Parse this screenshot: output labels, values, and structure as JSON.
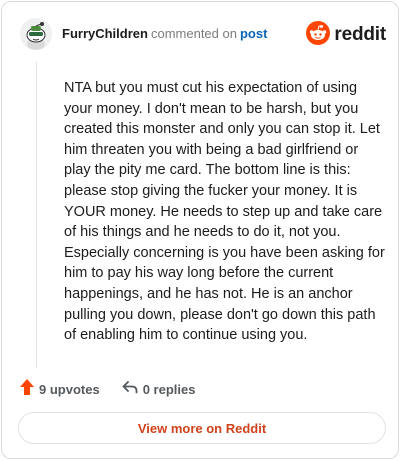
{
  "header": {
    "username": "FurryChildren",
    "action_text": "commented on",
    "post_link": "post",
    "brand_name": "reddit"
  },
  "icons": {
    "avatar": "snoo-avatar-icon",
    "brand": "reddit-logo-icon",
    "upvote": "upvote-arrow-icon",
    "reply": "reply-arrow-icon"
  },
  "comment": {
    "text": "NTA but you must cut his expectation of using your money. I don't mean to be harsh, but you created this monster and only you can stop it. Let him threaten you with being a bad girlfriend or play the pity me card. The bottom line is this: please stop giving the fucker your money. It is YOUR money. He needs to step up and take care of his things and he needs to do it, not you. Especially concerning is you have been asking for him to pay his way long before the current happenings, and he has not. He is an anchor pulling you down, please don't go down this path of enabling him to continue using you."
  },
  "stats": {
    "upvotes_label": "9 upvotes",
    "replies_label": "0 replies"
  },
  "footer": {
    "view_more_label": "View more on Reddit"
  },
  "colors": {
    "reddit_orange": "#FF4500",
    "link_blue": "#0B66B8",
    "button_text": "#D0421B"
  }
}
